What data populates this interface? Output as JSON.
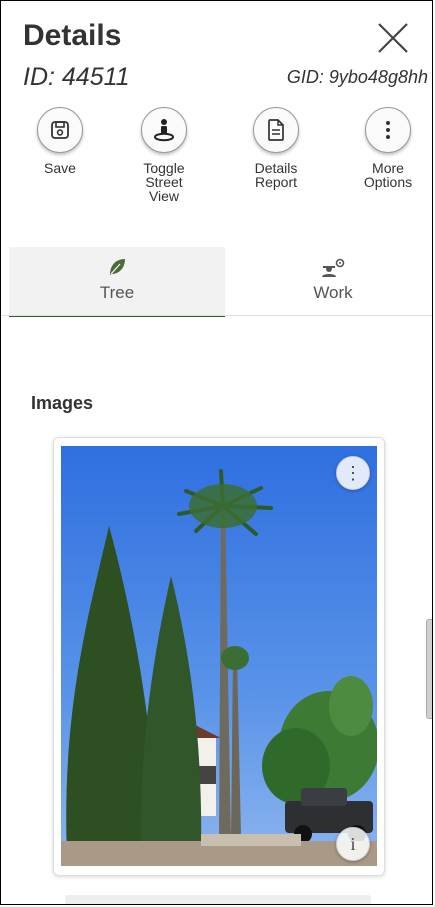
{
  "header": {
    "title": "Details",
    "id_text": "ID: 44511",
    "gid_text": "GID: 9ybo48g8hh"
  },
  "actions": [
    {
      "label": "Save",
      "icon": "save-icon"
    },
    {
      "label": "Toggle Street View",
      "icon": "street-view-icon"
    },
    {
      "label": "Details Report",
      "icon": "document-icon"
    },
    {
      "label": "More Options",
      "icon": "more-vertical-icon"
    }
  ],
  "tabs": [
    {
      "label": "Tree",
      "icon": "leaf-icon",
      "active": true
    },
    {
      "label": "Work",
      "icon": "worker-icon",
      "active": false
    }
  ],
  "images_section": {
    "title": "Images",
    "menu_glyph": "⋮",
    "info_glyph": "i"
  },
  "colors": {
    "tab_active_underline": "#3f5a36",
    "leaf_green": "#4a6b3a",
    "sky": "#4f86df"
  }
}
